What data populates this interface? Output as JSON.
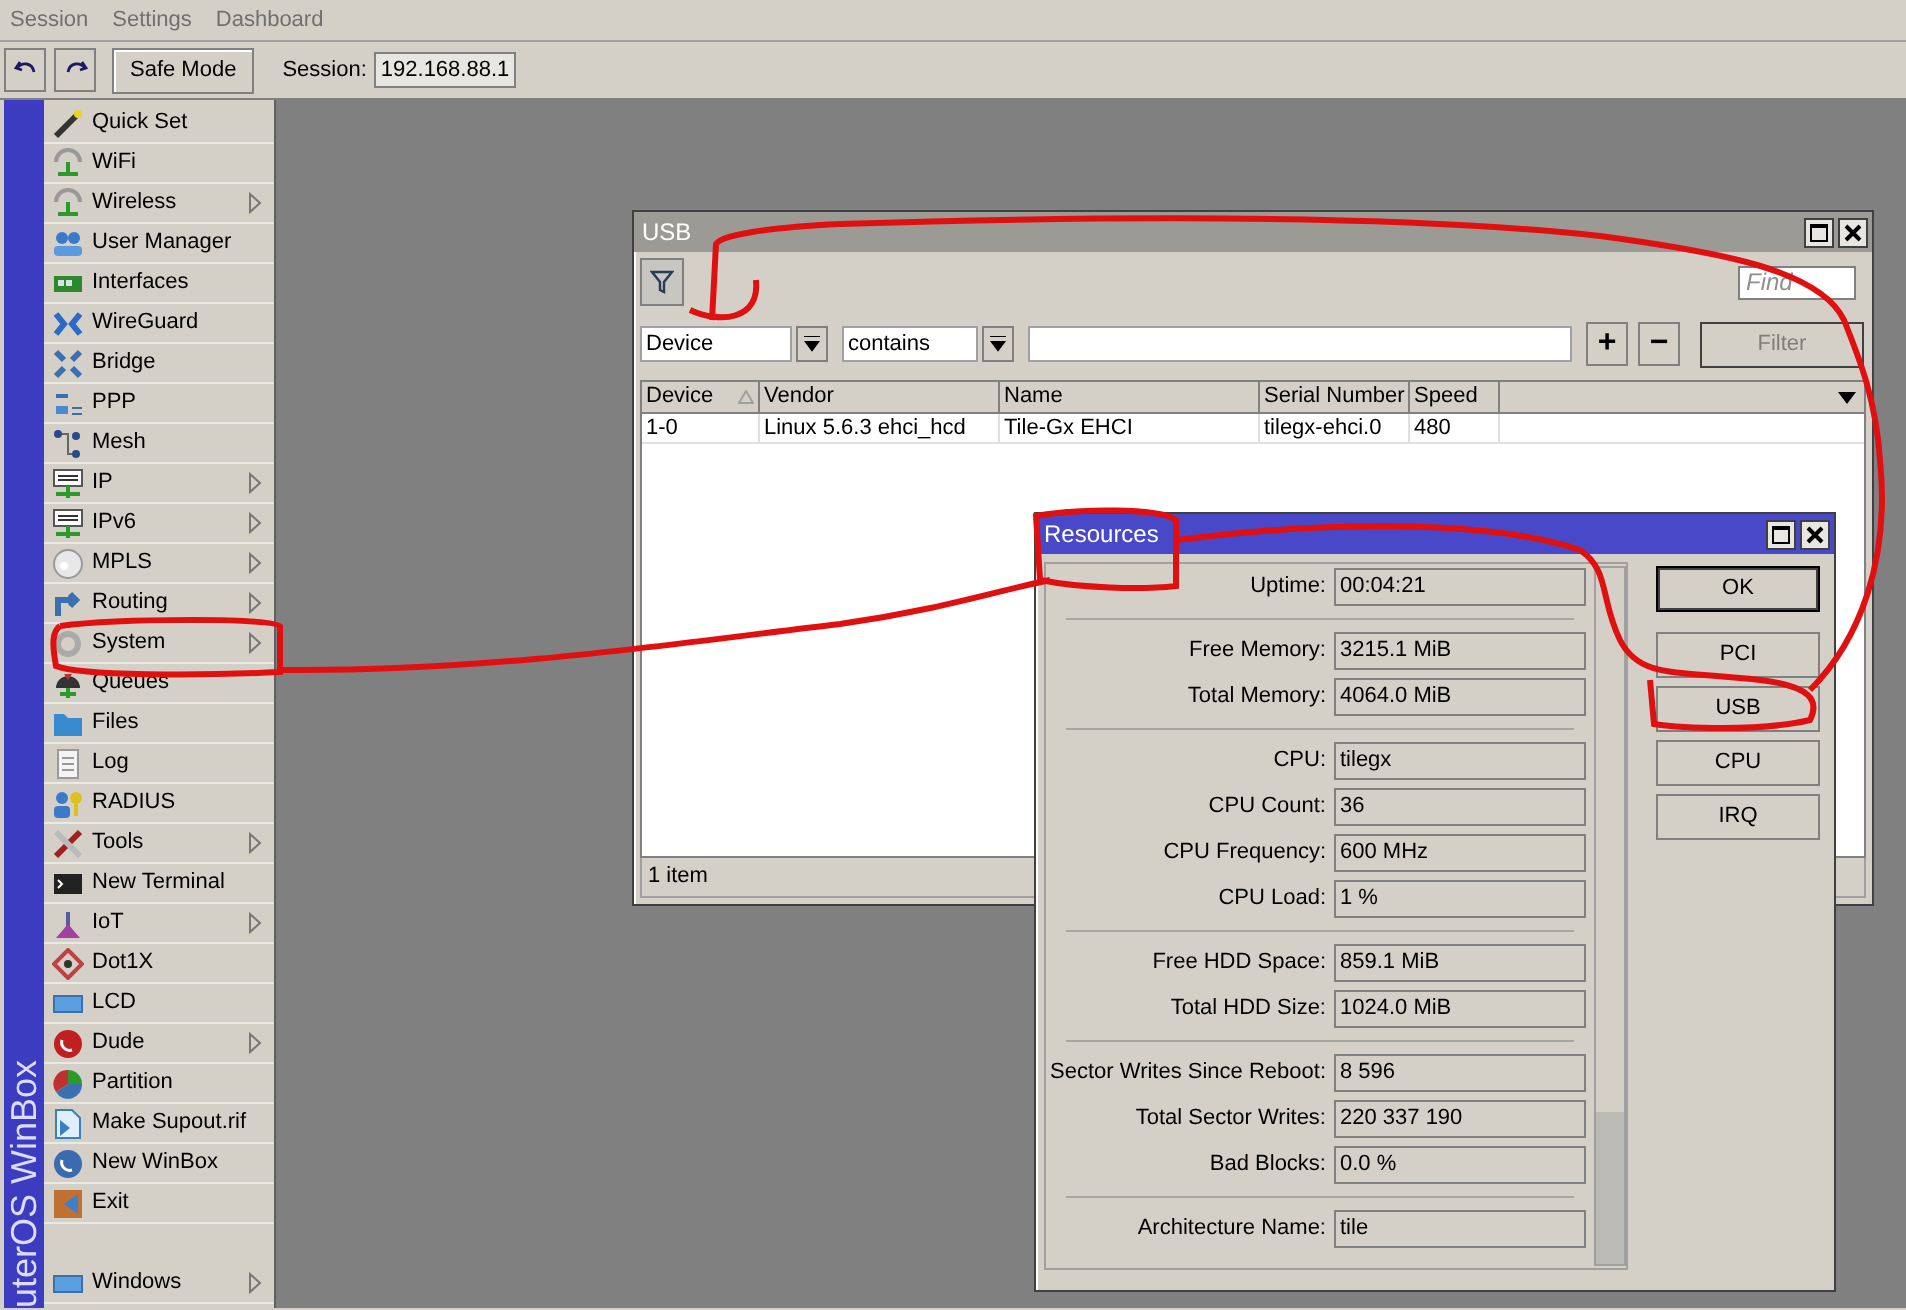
{
  "menu_bar": [
    "Session",
    "Settings",
    "Dashboard"
  ],
  "toolbar": {
    "safe_mode": "Safe Mode",
    "session_label": "Session:",
    "session_value": "192.168.88.1"
  },
  "sidebar": {
    "brand": "uterOS WinBox",
    "items": [
      {
        "label": "Quick Set",
        "submenu": false
      },
      {
        "label": "WiFi",
        "submenu": false
      },
      {
        "label": "Wireless",
        "submenu": true
      },
      {
        "label": "User Manager",
        "submenu": false
      },
      {
        "label": "Interfaces",
        "submenu": false
      },
      {
        "label": "WireGuard",
        "submenu": false
      },
      {
        "label": "Bridge",
        "submenu": false
      },
      {
        "label": "PPP",
        "submenu": false
      },
      {
        "label": "Mesh",
        "submenu": false
      },
      {
        "label": "IP",
        "submenu": true
      },
      {
        "label": "IPv6",
        "submenu": true
      },
      {
        "label": "MPLS",
        "submenu": true
      },
      {
        "label": "Routing",
        "submenu": true
      },
      {
        "label": "System",
        "submenu": true
      },
      {
        "label": "Queues",
        "submenu": false
      },
      {
        "label": "Files",
        "submenu": false
      },
      {
        "label": "Log",
        "submenu": false
      },
      {
        "label": "RADIUS",
        "submenu": false
      },
      {
        "label": "Tools",
        "submenu": true
      },
      {
        "label": "New Terminal",
        "submenu": false
      },
      {
        "label": "IoT",
        "submenu": true
      },
      {
        "label": "Dot1X",
        "submenu": false
      },
      {
        "label": "LCD",
        "submenu": false
      },
      {
        "label": "Dude",
        "submenu": true
      },
      {
        "label": "Partition",
        "submenu": false
      },
      {
        "label": "Make Supout.rif",
        "submenu": false
      },
      {
        "label": "New WinBox",
        "submenu": false
      },
      {
        "label": "Exit",
        "submenu": false
      }
    ],
    "bottom_item": {
      "label": "Windows",
      "submenu": true
    }
  },
  "usb_window": {
    "title": "USB",
    "active": false,
    "find_placeholder": "Find",
    "filter": {
      "field": "Device",
      "operator": "contains",
      "add": "+",
      "remove": "−",
      "apply": {
        "label": "Filter",
        "disabled": true
      }
    },
    "columns": [
      {
        "label": "Device",
        "sorted": true
      },
      {
        "label": "Vendor",
        "sorted": false
      },
      {
        "label": "Name",
        "sorted": false
      },
      {
        "label": "Serial Number",
        "sorted": false
      },
      {
        "label": "Speed",
        "sorted": false
      }
    ],
    "rows": [
      [
        "1-0",
        "Linux 5.6.3 ehci_hcd",
        "Tile-Gx EHCI",
        "tilegx-ehci.0",
        "480"
      ]
    ],
    "status": "1 item"
  },
  "resources_window": {
    "title": "Resources",
    "active": true,
    "groups": [
      [
        {
          "label": "Uptime:",
          "value": "00:04:21"
        }
      ],
      [
        {
          "label": "Free Memory:",
          "value": "3215.1 MiB"
        },
        {
          "label": "Total Memory:",
          "value": "4064.0 MiB"
        }
      ],
      [
        {
          "label": "CPU:",
          "value": "tilegx"
        },
        {
          "label": "CPU Count:",
          "value": "36"
        },
        {
          "label": "CPU Frequency:",
          "value": "600 MHz"
        },
        {
          "label": "CPU Load:",
          "value": "1 %"
        }
      ],
      [
        {
          "label": "Free HDD Space:",
          "value": "859.1 MiB"
        },
        {
          "label": "Total HDD Size:",
          "value": "1024.0 MiB"
        }
      ],
      [
        {
          "label": "Sector Writes Since Reboot:",
          "value": "8 596"
        },
        {
          "label": "Total Sector Writes:",
          "value": "220 337 190"
        },
        {
          "label": "Bad Blocks:",
          "value": "0.0 %"
        }
      ],
      [
        {
          "label": "Architecture Name:",
          "value": "tile"
        }
      ]
    ],
    "buttons": [
      {
        "label": "OK",
        "selected": true
      },
      {
        "label": "PCI",
        "selected": false
      },
      {
        "label": "USB",
        "selected": false
      },
      {
        "label": "CPU",
        "selected": false
      },
      {
        "label": "IRQ",
        "selected": false
      }
    ]
  }
}
